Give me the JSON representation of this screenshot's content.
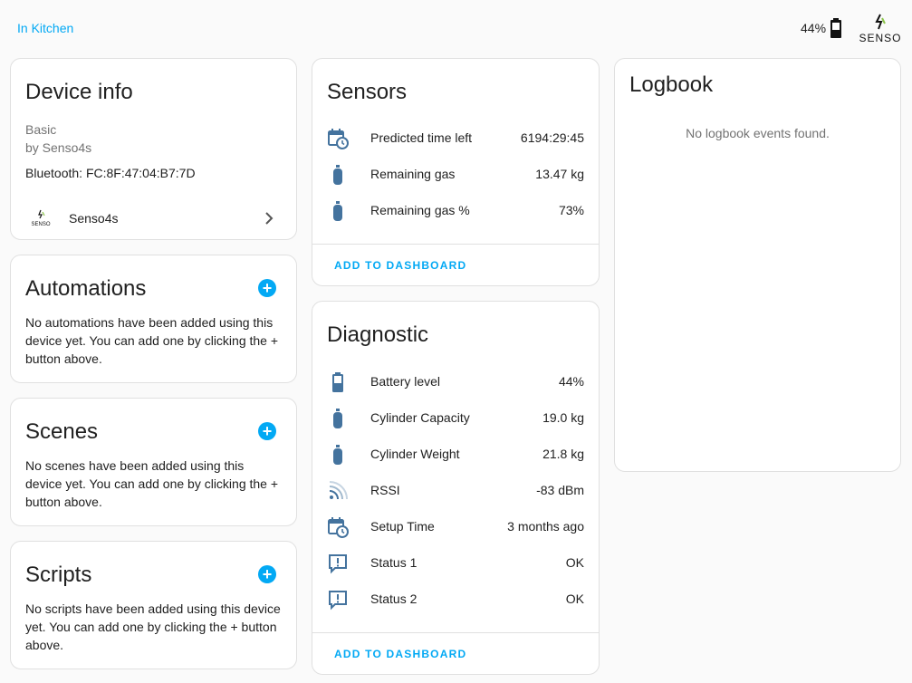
{
  "header": {
    "area_link": "In Kitchen",
    "battery": "44%"
  },
  "device_info": {
    "title": "Device info",
    "model": "Basic",
    "manufacturer": "by Senso4s",
    "connection": "Bluetooth: FC:8F:47:04:B7:7D",
    "integration": "Senso4s"
  },
  "automations": {
    "title": "Automations",
    "text": "No automations have been added using this device yet. You can add one by clicking the + button above."
  },
  "scenes": {
    "title": "Scenes",
    "text": "No scenes have been added using this device yet. You can add one by clicking the + button above."
  },
  "scripts": {
    "title": "Scripts",
    "text": "No scripts have been added using this device yet. You can add one by clicking the + button above."
  },
  "sensors": {
    "title": "Sensors",
    "rows": [
      {
        "icon": "calendar-clock-icon",
        "label": "Predicted time left",
        "value": "6194:29:45"
      },
      {
        "icon": "gas-cylinder-icon",
        "label": "Remaining gas",
        "value": "13.47 kg"
      },
      {
        "icon": "gas-cylinder-icon",
        "label": "Remaining gas %",
        "value": "73%"
      }
    ],
    "add_label": "ADD TO DASHBOARD"
  },
  "diagnostic": {
    "title": "Diagnostic",
    "rows": [
      {
        "icon": "battery-icon",
        "label": "Battery level",
        "value": "44%"
      },
      {
        "icon": "gas-cylinder-icon",
        "label": "Cylinder Capacity",
        "value": "19.0 kg"
      },
      {
        "icon": "gas-cylinder-icon",
        "label": "Cylinder Weight",
        "value": "21.8 kg"
      },
      {
        "icon": "wifi-signal-icon",
        "label": "RSSI",
        "value": "-83 dBm"
      },
      {
        "icon": "calendar-clock-icon",
        "label": "Setup Time",
        "value": "3 months ago"
      },
      {
        "icon": "alert-message-icon",
        "label": "Status 1",
        "value": "OK"
      },
      {
        "icon": "alert-message-icon",
        "label": "Status 2",
        "value": "OK"
      }
    ],
    "add_label": "ADD TO DASHBOARD"
  },
  "logbook": {
    "title": "Logbook",
    "empty": "No logbook events found."
  },
  "colors": {
    "accent": "#03a9f4",
    "icon": "#44739e",
    "background": "#fafafa",
    "card": "#ffffff"
  }
}
